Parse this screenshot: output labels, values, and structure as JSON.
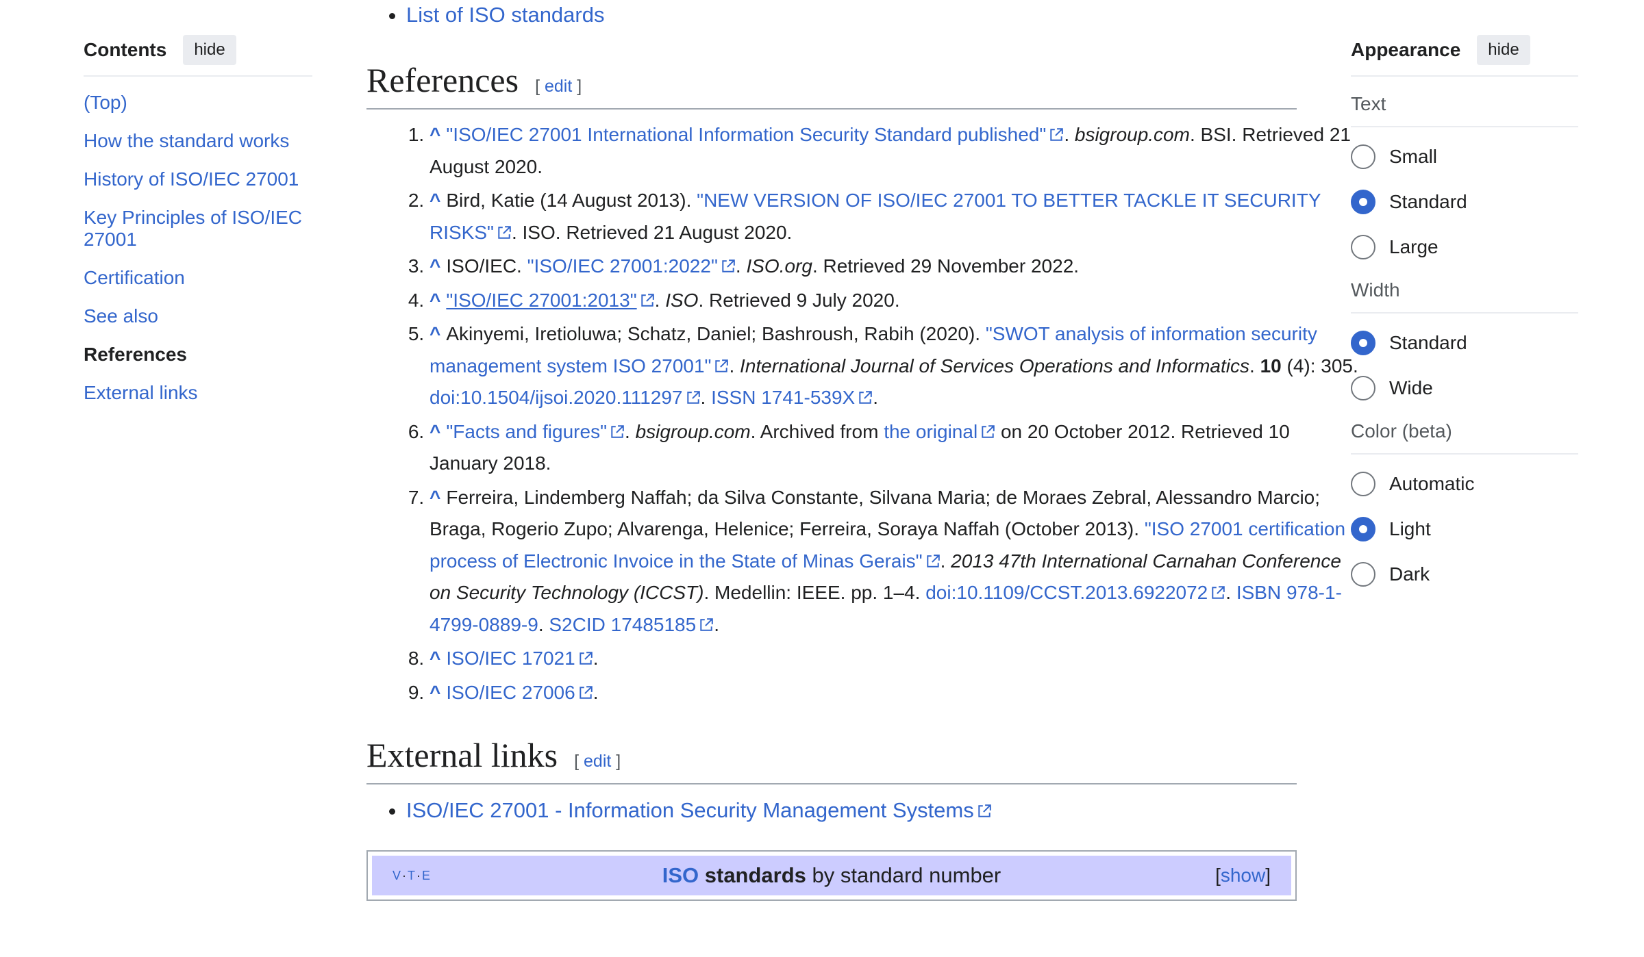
{
  "toc": {
    "title": "Contents",
    "hide_label": "hide",
    "items": [
      {
        "label": "(Top)"
      },
      {
        "label": "How the standard works"
      },
      {
        "label": "History of ISO/IEC 27001"
      },
      {
        "label": "Key Principles of ISO/IEC 27001"
      },
      {
        "label": "Certification"
      },
      {
        "label": "See also"
      },
      {
        "label": "References"
      },
      {
        "label": "External links"
      }
    ],
    "active": "References"
  },
  "see_also": {
    "item": "List of ISO standards"
  },
  "references": {
    "heading": "References",
    "edit_open": "[ ",
    "edit_label": "edit",
    "edit_close": " ]",
    "caret": "^",
    "items": [
      {
        "link": "\"ISO/IEC 27001 International Information Security Standard published\"",
        "t1": ". ",
        "work": "bsigroup.com",
        "t2": ". BSI. Retrieved 21 August 2020."
      },
      {
        "pre": "Bird, Katie (14 August 2013). ",
        "link": "\"NEW VERSION OF ISO/IEC 27001 TO BETTER TACKLE IT SECURITY RISKS\"",
        "t2": ". ISO. Retrieved 21 August 2020."
      },
      {
        "pre": "ISO/IEC. ",
        "link": "\"ISO/IEC 27001:2022\"",
        "t1": ". ",
        "work": "ISO.org",
        "t2": ". Retrieved 29 November 2022."
      },
      {
        "link": "\"ISO/IEC 27001:2013\"",
        "t1": ". ",
        "work": "ISO",
        "t2": ". Retrieved 9 July 2020."
      },
      {
        "pre": "Akinyemi, Iretioluwa; Schatz, Daniel; Bashroush, Rabih (2020). ",
        "link": "\"SWOT analysis of information security management system ISO 27001\"",
        "t1": ". ",
        "work": "International Journal of Services Operations and Informatics",
        "t2": ". ",
        "vol": "10",
        "t3": " (4): 305. ",
        "doi_prefix": "doi",
        "doi": ":10.1504/ijsoi.2020.111297",
        "t4": ". ",
        "issn": "ISSN 1741-539X",
        "t5": "."
      },
      {
        "link": "\"Facts and figures\"",
        "t1": ". ",
        "work": "bsigroup.com",
        "t2": ". Archived from ",
        "link2": "the original",
        "t3": " on 20 October 2012. Retrieved 10 January 2018."
      },
      {
        "pre": "Ferreira, Lindemberg Naffah; da Silva Constante, Silvana Maria; de Moraes Zebral, Alessandro Marcio; Braga, Rogerio Zupo; Alvarenga, Helenice; Ferreira, Soraya Naffah (October 2013). ",
        "link": "\"ISO 27001 certification process of Electronic Invoice in the State of Minas Gerais\"",
        "t1": ". ",
        "work": "2013 47th International Carnahan Conference on Security Technology (ICCST)",
        "t2": ". Medellin: IEEE. pp. 1–4. ",
        "doi_prefix": "doi",
        "doi": ":10.1109/CCST.2013.6922072",
        "t3": ". ",
        "isbn": "ISBN 978-1-4799-0889-9",
        "t4": ". ",
        "s2cid": "S2CID 17485185",
        "t5": "."
      },
      {
        "link": "ISO/IEC 17021",
        "t1": "."
      },
      {
        "link": "ISO/IEC 27006",
        "t1": "."
      }
    ]
  },
  "external_links": {
    "heading": "External links",
    "edit_open": "[ ",
    "edit_label": "edit",
    "edit_close": " ]",
    "items": [
      {
        "label": "ISO/IEC 27001 - Information Security Management Systems"
      }
    ]
  },
  "navbox": {
    "v": "V",
    "t": "T",
    "e": "E",
    "dot": "·",
    "title_link": "ISO",
    "title_bold": " standards",
    "title_rest": " by standard number",
    "show_open": "[",
    "show_label": "show",
    "show_close": "]"
  },
  "appearance": {
    "title": "Appearance",
    "hide_label": "hide",
    "text": {
      "label": "Text",
      "options": [
        "Small",
        "Standard",
        "Large"
      ],
      "selected": "Standard"
    },
    "width": {
      "label": "Width",
      "options": [
        "Standard",
        "Wide"
      ],
      "selected": "Standard"
    },
    "color": {
      "label": "Color (beta)",
      "options": [
        "Automatic",
        "Light",
        "Dark"
      ],
      "selected": "Light"
    },
    "accent_color": "#3366cc"
  }
}
